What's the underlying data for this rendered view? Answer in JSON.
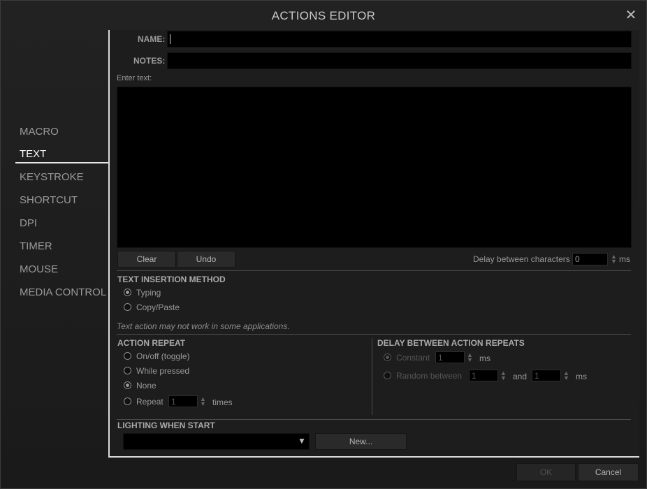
{
  "window": {
    "title": "ACTIONS EDITOR"
  },
  "nav": {
    "items": [
      {
        "label": "MACRO"
      },
      {
        "label": "TEXT"
      },
      {
        "label": "KEYSTROKE"
      },
      {
        "label": "SHORTCUT"
      },
      {
        "label": "DPI"
      },
      {
        "label": "TIMER"
      },
      {
        "label": "MOUSE"
      },
      {
        "label": "MEDIA CONTROL"
      }
    ],
    "active": "TEXT"
  },
  "form": {
    "name_label": "NAME:",
    "name_value": "",
    "notes_label": "NOTES:",
    "notes_value": "",
    "enter_text_label": "Enter text:",
    "text_value": "",
    "clear_label": "Clear",
    "undo_label": "Undo",
    "delay_chars_label": "Delay between characters",
    "delay_chars_value": "0",
    "delay_chars_unit": "ms"
  },
  "insertion": {
    "heading": "TEXT INSERTION METHOD",
    "options": [
      {
        "label": "Typing",
        "selected": true
      },
      {
        "label": "Copy/Paste",
        "selected": false
      }
    ],
    "warning": "Text action may not work in some applications."
  },
  "repeat": {
    "heading": "ACTION REPEAT",
    "options": [
      {
        "label": "On/off (toggle)",
        "selected": false
      },
      {
        "label": "While pressed",
        "selected": false
      },
      {
        "label": "None",
        "selected": true
      },
      {
        "label": "Repeat",
        "selected": false
      }
    ],
    "repeat_value": "1",
    "repeat_unit": "times"
  },
  "delay_repeats": {
    "heading": "DELAY BETWEEN ACTION REPEATS",
    "constant_label": "Constant",
    "constant_value": "1",
    "constant_unit": "ms",
    "random_label": "Random between",
    "random_min": "1",
    "and_label": "and",
    "random_max": "1",
    "random_unit": "ms"
  },
  "lighting": {
    "heading": "LIGHTING WHEN START",
    "selected": "",
    "new_label": "New..."
  },
  "footer": {
    "ok_label": "OK",
    "cancel_label": "Cancel"
  }
}
